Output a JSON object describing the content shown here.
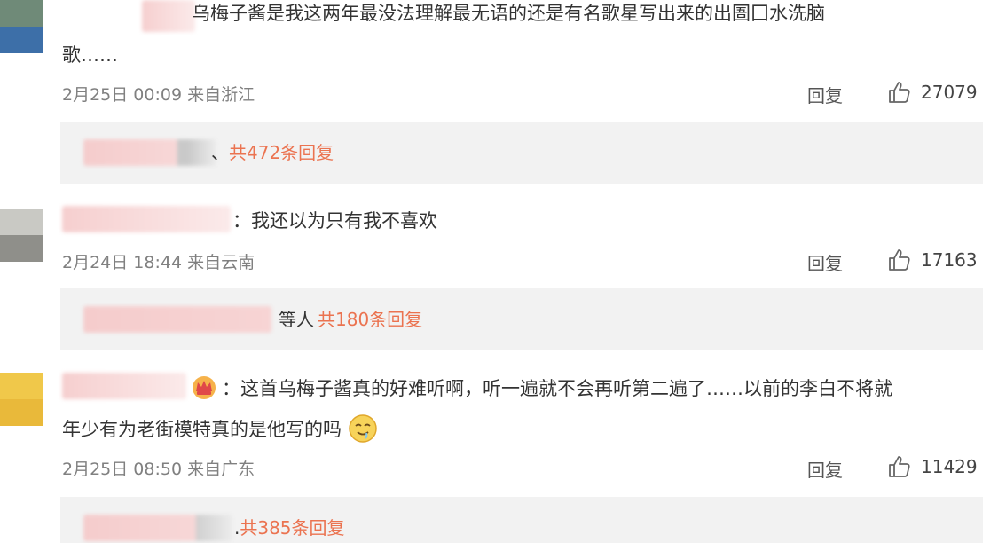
{
  "comments": [
    {
      "text_line1": "乌梅子酱是我这两年最没法理解最无语的还是有名歌星写出来的出圄囗水洗脑",
      "text_line2": "歌……",
      "date": "2月25日 00:09",
      "location": "来自浙江",
      "reply_label": "回复",
      "like_count": "27079",
      "sub_total": "共472条回复"
    },
    {
      "text_line1": "：我还以为只有我不喜欢",
      "date": "2月24日 18:44",
      "location": "来自云南",
      "reply_label": "回复",
      "like_count": "17163",
      "sub_others": "等人",
      "sub_total": "共180条回复"
    },
    {
      "text_line1": "：这首乌梅子酱真的好难听啊，听一遍就不会再听第二遍了……以前的李白不将就",
      "text_line2": "年少有为老街模特真的是他写的吗",
      "date": "2月25日 08:50",
      "location": "来自广东",
      "reply_label": "回复",
      "like_count": "11429",
      "sub_total": "共385条回复"
    }
  ],
  "colors": {
    "meta_text": "#808080",
    "sub_total": "#eb7350",
    "sub_bg": "#f2f2f2"
  },
  "icons": [
    "thumbs-up-icon",
    "crown-badge-icon",
    "drooling-face-emoji"
  ]
}
